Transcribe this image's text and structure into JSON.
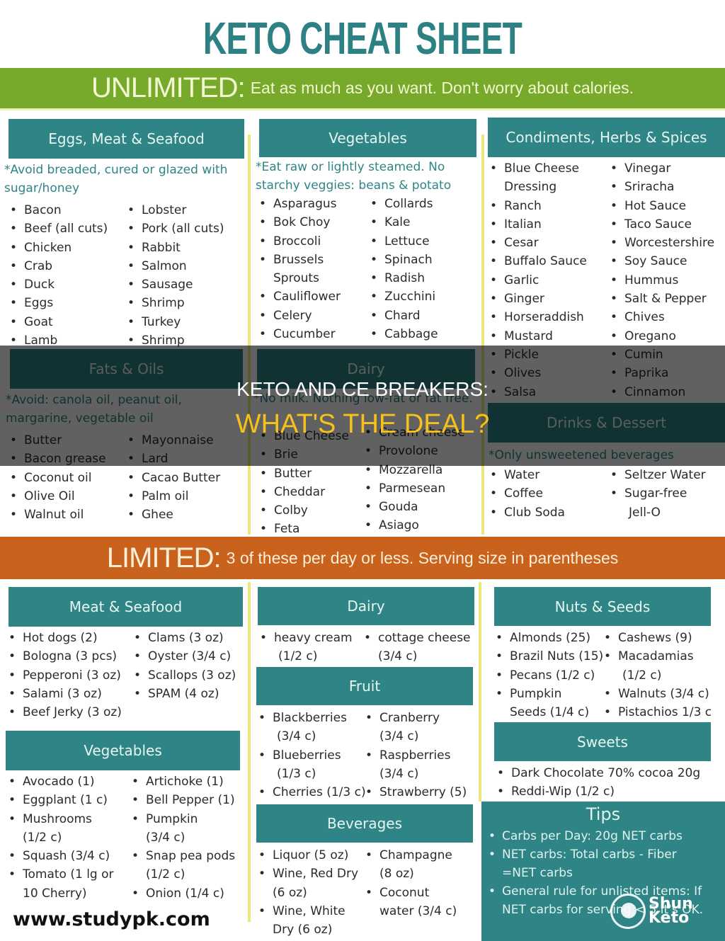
{
  "title": "KETO CHEAT SHEET",
  "unlimited": {
    "label": "UNLIMITED:",
    "description": "Eat as much as you want. Don't worry about calories.",
    "sections": {
      "eggs_meat_seafood": {
        "heading": "Eggs, Meat & Seafood",
        "note": "*Avoid breaded, cured or glazed with sugar/honey",
        "col1": [
          "Bacon",
          "Beef (all cuts)",
          "Chicken",
          "Crab",
          "Duck",
          "Eggs",
          "Goat",
          "Lamb"
        ],
        "col2": [
          "Lobster",
          "Pork (all cuts)",
          "Rabbit",
          "Salmon",
          "Sausage",
          "Shrimp",
          "Turkey",
          "Shrimp"
        ]
      },
      "vegetables": {
        "heading": "Vegetables",
        "note": "*Eat raw or lightly steamed. No starchy veggies: beans & potato",
        "col1": [
          "Asparagus",
          "Bok Choy",
          "Broccoli",
          "Brussels",
          "Sprouts",
          "Cauliflower",
          "Celery",
          "Cucumber"
        ],
        "col2": [
          "Collards",
          "Kale",
          "Lettuce",
          "Spinach",
          "Radish",
          "Zucchini",
          "Chard",
          "Cabbage"
        ]
      },
      "condiments": {
        "heading": "Condiments, Herbs & Spices",
        "col1": [
          "Blue Cheese",
          "Dressing",
          "Ranch",
          "Italian",
          "Cesar",
          "Buffalo Sauce",
          "Garlic",
          "Ginger",
          "Horseraddish",
          "Mustard",
          "Pickle",
          "Olives",
          "Salsa"
        ],
        "col2": [
          "Vinegar",
          "Sriracha",
          "Hot Sauce",
          "Taco Sauce",
          "Worcestershire",
          "Soy Sauce",
          "Hummus",
          "Salt & Pepper",
          "Chives",
          "Oregano",
          "Cumin",
          "Paprika",
          "Cinnamon"
        ]
      },
      "fats_oils": {
        "heading": "Fats & Oils",
        "note": "*Avoid: canola oil, peanut oil, margarine, vegetable oil",
        "col1": [
          "Butter",
          "Bacon grease",
          "Coconut oil",
          "Olive Oil",
          "Walnut oil"
        ],
        "col2": [
          "Mayonnaise",
          "Lard",
          "Cacao Butter",
          "Palm oil",
          "Ghee"
        ]
      },
      "dairy": {
        "heading": "Dairy",
        "note": "*No milk. Nothing low-fat or fat free.",
        "col1": [
          "Blue Cheese",
          "Brie",
          "Butter",
          "Cheddar",
          "Colby",
          "Feta"
        ],
        "col2": [
          "Cream cheese",
          "Provolone",
          "Mozzarella",
          "Parmesean",
          "Gouda",
          "Asiago"
        ]
      },
      "drinks_dessert": {
        "heading": "Drinks & Dessert",
        "note": "*Only unsweetened beverages",
        "col1": [
          "Water",
          "Coffee",
          "Club Soda"
        ],
        "col2": [
          "Seltzer Water",
          "Sugar-free",
          "Jell-O"
        ]
      }
    }
  },
  "limited": {
    "label": "LIMITED:",
    "description": "3 of these per day or less. Serving size in parentheses",
    "sections": {
      "meat_seafood": {
        "heading": "Meat & Seafood",
        "col1": [
          "Hot dogs (2)",
          "Bologna (3 pcs)",
          "Pepperoni (3 oz)",
          "Salami (3 oz)",
          "Beef Jerky (3 oz)"
        ],
        "col2": [
          "Clams (3 oz)",
          "Oyster (3/4 c)",
          "Scallops (3 oz)",
          "SPAM (4 oz)"
        ]
      },
      "vegetables": {
        "heading": "Vegetables",
        "col1": [
          "Avocado (1)",
          "Eggplant (1 c)",
          "Mushrooms",
          "(1/2 c)",
          "Squash (3/4 c)",
          "Tomato (1 lg or",
          "10 Cherry)"
        ],
        "col2": [
          "Artichoke (1)",
          "Bell Pepper (1)",
          "Pumpkin",
          "(3/4 c)",
          "Snap pea pods",
          "(1/2 c)",
          "Onion (1/4 c)"
        ]
      },
      "dairy": {
        "heading": "Dairy",
        "col1": [
          "heavy cream",
          "(1/2 c)"
        ],
        "col2": [
          "cottage cheese",
          "(3/4 c)"
        ]
      },
      "fruit": {
        "heading": "Fruit",
        "col1": [
          "Blackberries",
          "(3/4 c)",
          "Blueberries",
          "(1/3 c)",
          "Cherries (1/3 c)"
        ],
        "col2": [
          "Cranberry",
          "(3/4 c)",
          "Raspberries",
          "(3/4 c)",
          "Strawberry (5)"
        ]
      },
      "beverages": {
        "heading": "Beverages",
        "col1": [
          "Liquor (5 oz)",
          "Wine, Red Dry",
          "(6 oz)",
          "Wine, White",
          "Dry (6 oz)"
        ],
        "col2": [
          "Champagne",
          "(8 oz)",
          "Coconut",
          "water (3/4 c)"
        ]
      },
      "nuts_seeds": {
        "heading": "Nuts & Seeds",
        "col1": [
          "Almonds (25)",
          "Brazil Nuts (15)",
          "Pecans (1/2 c)",
          "Pumpkin",
          "Seeds (1/4 c)"
        ],
        "col2": [
          "Cashews (9)",
          "Macadamias",
          "(1/2 c)",
          "Walnuts (3/4 c)",
          "Pistachios 1/3 c"
        ]
      },
      "sweets": {
        "heading": "Sweets",
        "items": [
          "Dark Chocolate 70% cocoa 20g",
          "Reddi-Wip (1/2 c)"
        ]
      }
    }
  },
  "tips": {
    "heading": "Tips",
    "items": [
      "Carbs per Day: 20g NET carbs",
      "NET carbs: Total carbs - Fiber",
      "=NET carbs",
      "General rule for unlisted items: If",
      "NET carbs for serving < 5 it's OK."
    ]
  },
  "logo": {
    "line1": "Shun",
    "line2": "Keto"
  },
  "watermark": "www.studypk.com",
  "overlay": {
    "line1": "KETO AND CE BREAKERS:",
    "line2": "WHAT'S THE DEAL?"
  },
  "colors": {
    "teal": "#2f8486",
    "green": "#77aa2a",
    "orange": "#c8621c",
    "divider": "#ece77a",
    "overlay_accent": "#f5c11a"
  }
}
